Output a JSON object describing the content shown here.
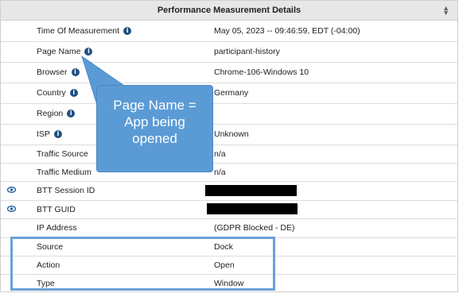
{
  "header": {
    "title": "Performance Measurement Details"
  },
  "rows": [
    {
      "label": "Time Of Measurement",
      "value": "May 05, 2023 -- 09:46:59, EDT (-04:00)"
    },
    {
      "label": "Page Name",
      "value": "participant-history"
    },
    {
      "label": "Browser",
      "value": "Chrome-106-Windows 10"
    },
    {
      "label": "Country",
      "value": "Germany"
    },
    {
      "label": "Region",
      "value": ""
    },
    {
      "label": "ISP",
      "value": "Unknown"
    },
    {
      "label": "Traffic Source",
      "value": "n/a"
    },
    {
      "label": "Traffic Medium",
      "value": "n/a"
    },
    {
      "label": "BTT Session ID",
      "value": ""
    },
    {
      "label": "BTT GUID",
      "value": ""
    },
    {
      "label": "IP Address",
      "value": "(GDPR Blocked - DE)"
    },
    {
      "label": "Source",
      "value": "Dock"
    },
    {
      "label": "Action",
      "value": "Open"
    },
    {
      "label": "Type",
      "value": "Window"
    }
  ],
  "callout": {
    "lines": [
      "Page Name =",
      "App being",
      "opened"
    ]
  },
  "icons": {
    "info": "info-icon",
    "eye": "eye-icon",
    "sort": "sort-icon"
  },
  "colors": {
    "info": "#1f4f82",
    "eye": "#1f5f99",
    "callout": "#5b9bd5",
    "highlight": "#6c9fd6"
  }
}
